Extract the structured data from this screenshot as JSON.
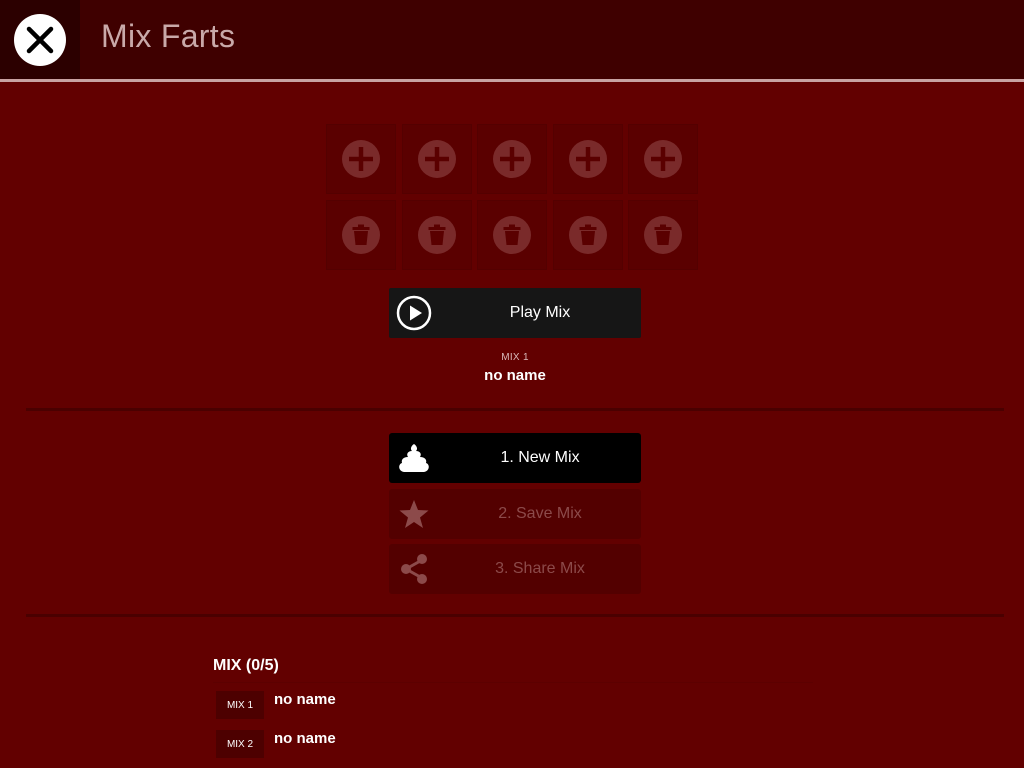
{
  "header": {
    "title": "Mix Farts",
    "close_icon": "close-icon"
  },
  "slots": {
    "add_icon": "plus-circle-icon",
    "delete_icon": "trash-circle-icon",
    "count": 5
  },
  "player": {
    "play_label": "Play Mix",
    "play_icon": "play-circle-icon",
    "mix_caption": "MIX 1",
    "mix_name": "no name"
  },
  "actions": [
    {
      "label": "1.  New Mix",
      "icon": "poop-icon",
      "enabled": true
    },
    {
      "label": "2.  Save Mix",
      "icon": "star-icon",
      "enabled": false
    },
    {
      "label": "3.  Share Mix",
      "icon": "share-icon",
      "enabled": false
    }
  ],
  "mix_list": {
    "title": "MIX (0/5)",
    "items": [
      {
        "badge": "MIX 1",
        "name": "no name"
      },
      {
        "badge": "MIX 2",
        "name": "no name"
      }
    ]
  },
  "colors": {
    "background": "#620000",
    "header": "#3f0000",
    "slot": "#5a0000",
    "slot_icon": "#7a2a2a",
    "play_button": "#161616",
    "active_button": "#000000",
    "disabled_button": "#530000"
  }
}
